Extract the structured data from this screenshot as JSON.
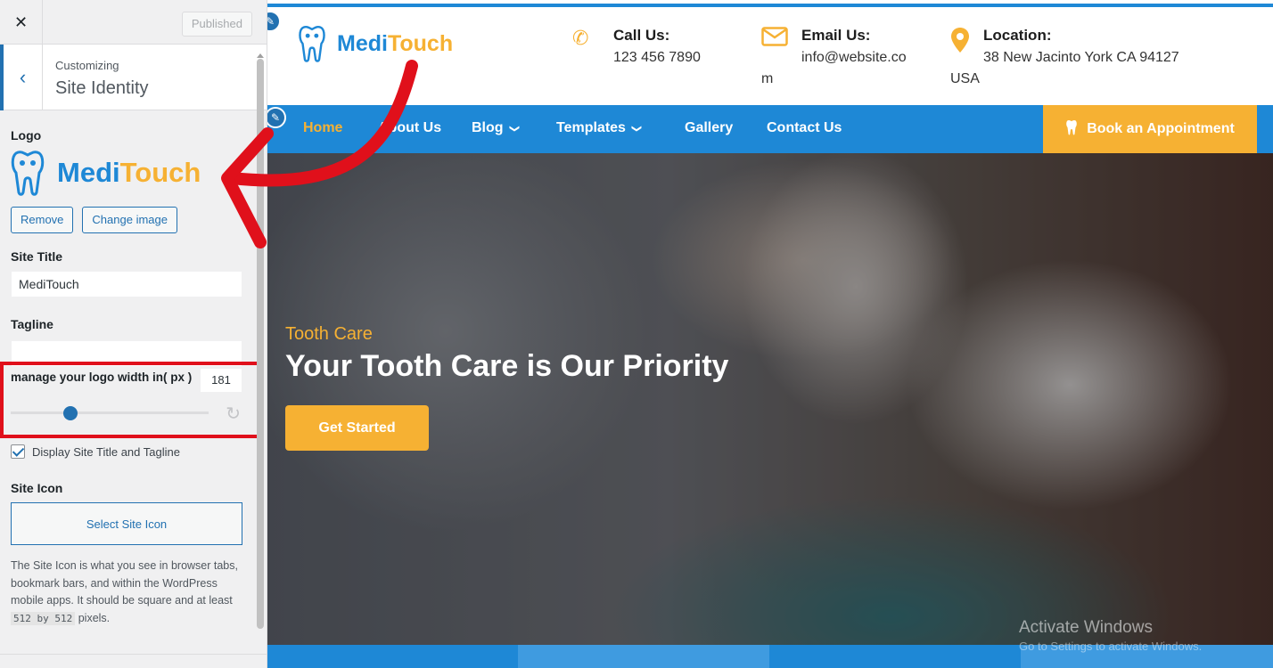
{
  "sidebar": {
    "close_label": "✕",
    "published_label": "Published",
    "back_label": "‹",
    "customizing_label": "Customizing",
    "section_title": "Site Identity",
    "logo_label": "Logo",
    "logo": {
      "part1": "Medi",
      "part2": "Touch"
    },
    "remove_label": "Remove",
    "change_image_label": "Change image",
    "site_title_label": "Site Title",
    "site_title_value": "MediTouch",
    "tagline_label": "Tagline",
    "tagline_value": "",
    "logo_width_label": "manage your logo width in( px )",
    "logo_width_value": "181",
    "logo_width_slider_fraction": 0.3,
    "reset_icon": "↻",
    "display_title_label": "Display Site Title and Tagline",
    "display_title_checked": true,
    "site_icon_label": "Site Icon",
    "select_site_icon_label": "Select Site Icon",
    "site_icon_desc": "The Site Icon is what you see in browser tabs, bookmark bars, and within the WordPress mobile apps. It should be square and at least",
    "site_icon_size": "512 by 512",
    "site_icon_desc_end": "pixels."
  },
  "site": {
    "logo": {
      "part1": "Medi",
      "part2": "Touch"
    },
    "call": {
      "title": "Call Us:",
      "value": "123 456 7890"
    },
    "email": {
      "title": "Email Us:",
      "value_line1": "info@website.co",
      "value_line2": "m"
    },
    "location": {
      "title": "Location:",
      "value_line1": "38 New Jacinto York CA 94127",
      "value_line2": "USA"
    },
    "nav": [
      {
        "label": "Home",
        "active": true
      },
      {
        "label": "About Us"
      },
      {
        "label": "Blog"
      },
      {
        "label": "Templates"
      },
      {
        "label": "Gallery"
      },
      {
        "label": "Contact Us"
      }
    ],
    "book_label": "Book an Appointment",
    "hero": {
      "subtitle": "Tooth Care",
      "title": "Your Tooth Care is Our Priority",
      "button": "Get Started"
    }
  },
  "watermark": {
    "line1": "Activate Windows",
    "line2": "Go to Settings to activate Windows."
  },
  "colors": {
    "brand_blue": "#1e88d6",
    "brand_orange": "#f6b133",
    "wp_blue": "#2271b1",
    "annotation_red": "#e0101b"
  }
}
